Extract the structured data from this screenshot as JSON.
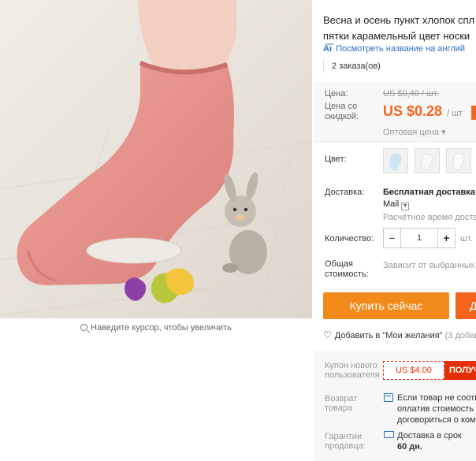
{
  "product_image": {
    "name": "pink-sock-photo"
  },
  "zoom_hint": "Наведите курсор, чтобы увеличить",
  "title_line1": "Весна и осень пункт хлопок спл",
  "title_line2": "пятки карамельный цвет носки",
  "translate_link": "Посмотреть название на англий",
  "orders": "2 заказа(ов)",
  "price": {
    "label": "Цена:",
    "old": "US $0,40 / шт.",
    "discount_label_1": "Цена со",
    "discount_label_2": "скидкой:",
    "new": "US $0.28",
    "unit": "/ шт",
    "wholesale": "Оптовая цена ▾",
    "accent": "#f5641e"
  },
  "color": {
    "label": "Цвет:",
    "swatches": [
      "sky-blue-sock",
      "white-sock",
      "white-sock-2"
    ]
  },
  "shipping": {
    "label": "Доставка:",
    "value": "Бесплатная доставка в",
    "carrier": "Mail",
    "estimate": "Расчётное время доставки"
  },
  "quantity": {
    "label": "Количество:",
    "value": "1",
    "minus": "−",
    "plus": "+",
    "unit": "шт."
  },
  "total": {
    "label_1": "Общая",
    "label_2": "стоимость:",
    "value": "Зависит от выбранных"
  },
  "buttons": {
    "buy_now": "Купить сейчас",
    "add_to_cart": "Д"
  },
  "wishlist": {
    "label": "Добавить в \"Мои желания\"",
    "count": "(3 добав"
  },
  "coupon": {
    "label_1": "Купон нового",
    "label_2": "пользователя",
    "amount": "US $4.00",
    "get": "ПОЛУЧ"
  },
  "returns": {
    "label_1": "Возврат",
    "label_2": "товара",
    "line1": "Если товар не соотв",
    "line2": "оплатив стоимость с",
    "line3": "договориться о ком"
  },
  "guarantee": {
    "label_1": "Гарантии",
    "label_2": "продавца:",
    "line1": "Доставка в срок",
    "line2": "60 дн."
  },
  "colors": {
    "accent_orange": "#f28a1b",
    "accent_red": "#e62e04",
    "link_blue": "#2a6ec9",
    "sock_pink": "#e8938d"
  }
}
